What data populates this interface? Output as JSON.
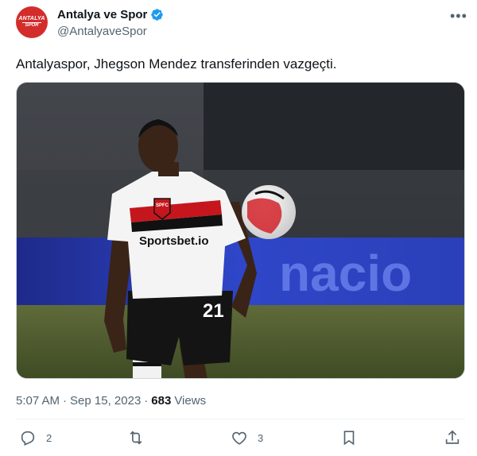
{
  "author": {
    "display_name": "Antalya ve Spor",
    "handle": "@AntalyaveSpor",
    "avatar_line1": "ANTALYA",
    "avatar_line2": "SPOR",
    "verified": true,
    "verified_color": "#1d9bf0"
  },
  "tweet": {
    "text": "Antalyaspor, Jhegson Mendez transferinden vazgeçti.",
    "time": "5:07 AM",
    "date": "Sep 15, 2023",
    "views_count": "683",
    "views_label": "Views"
  },
  "media": {
    "jersey_sponsor": "Sportsbet.io",
    "jersey_crest": "SPFC",
    "jersey_number": "21",
    "background_banner": "nacio",
    "icon": "photo-player"
  },
  "actions": {
    "reply_count": "2",
    "retweet_count": "",
    "like_count": "3"
  },
  "icons": {
    "more": "more-icon",
    "reply": "reply-icon",
    "retweet": "retweet-icon",
    "like": "heart-icon",
    "bookmark": "bookmark-icon",
    "share": "share-icon"
  },
  "colors": {
    "text": "#0f1419",
    "secondary": "#536471",
    "brand_red": "#d32d2b"
  }
}
